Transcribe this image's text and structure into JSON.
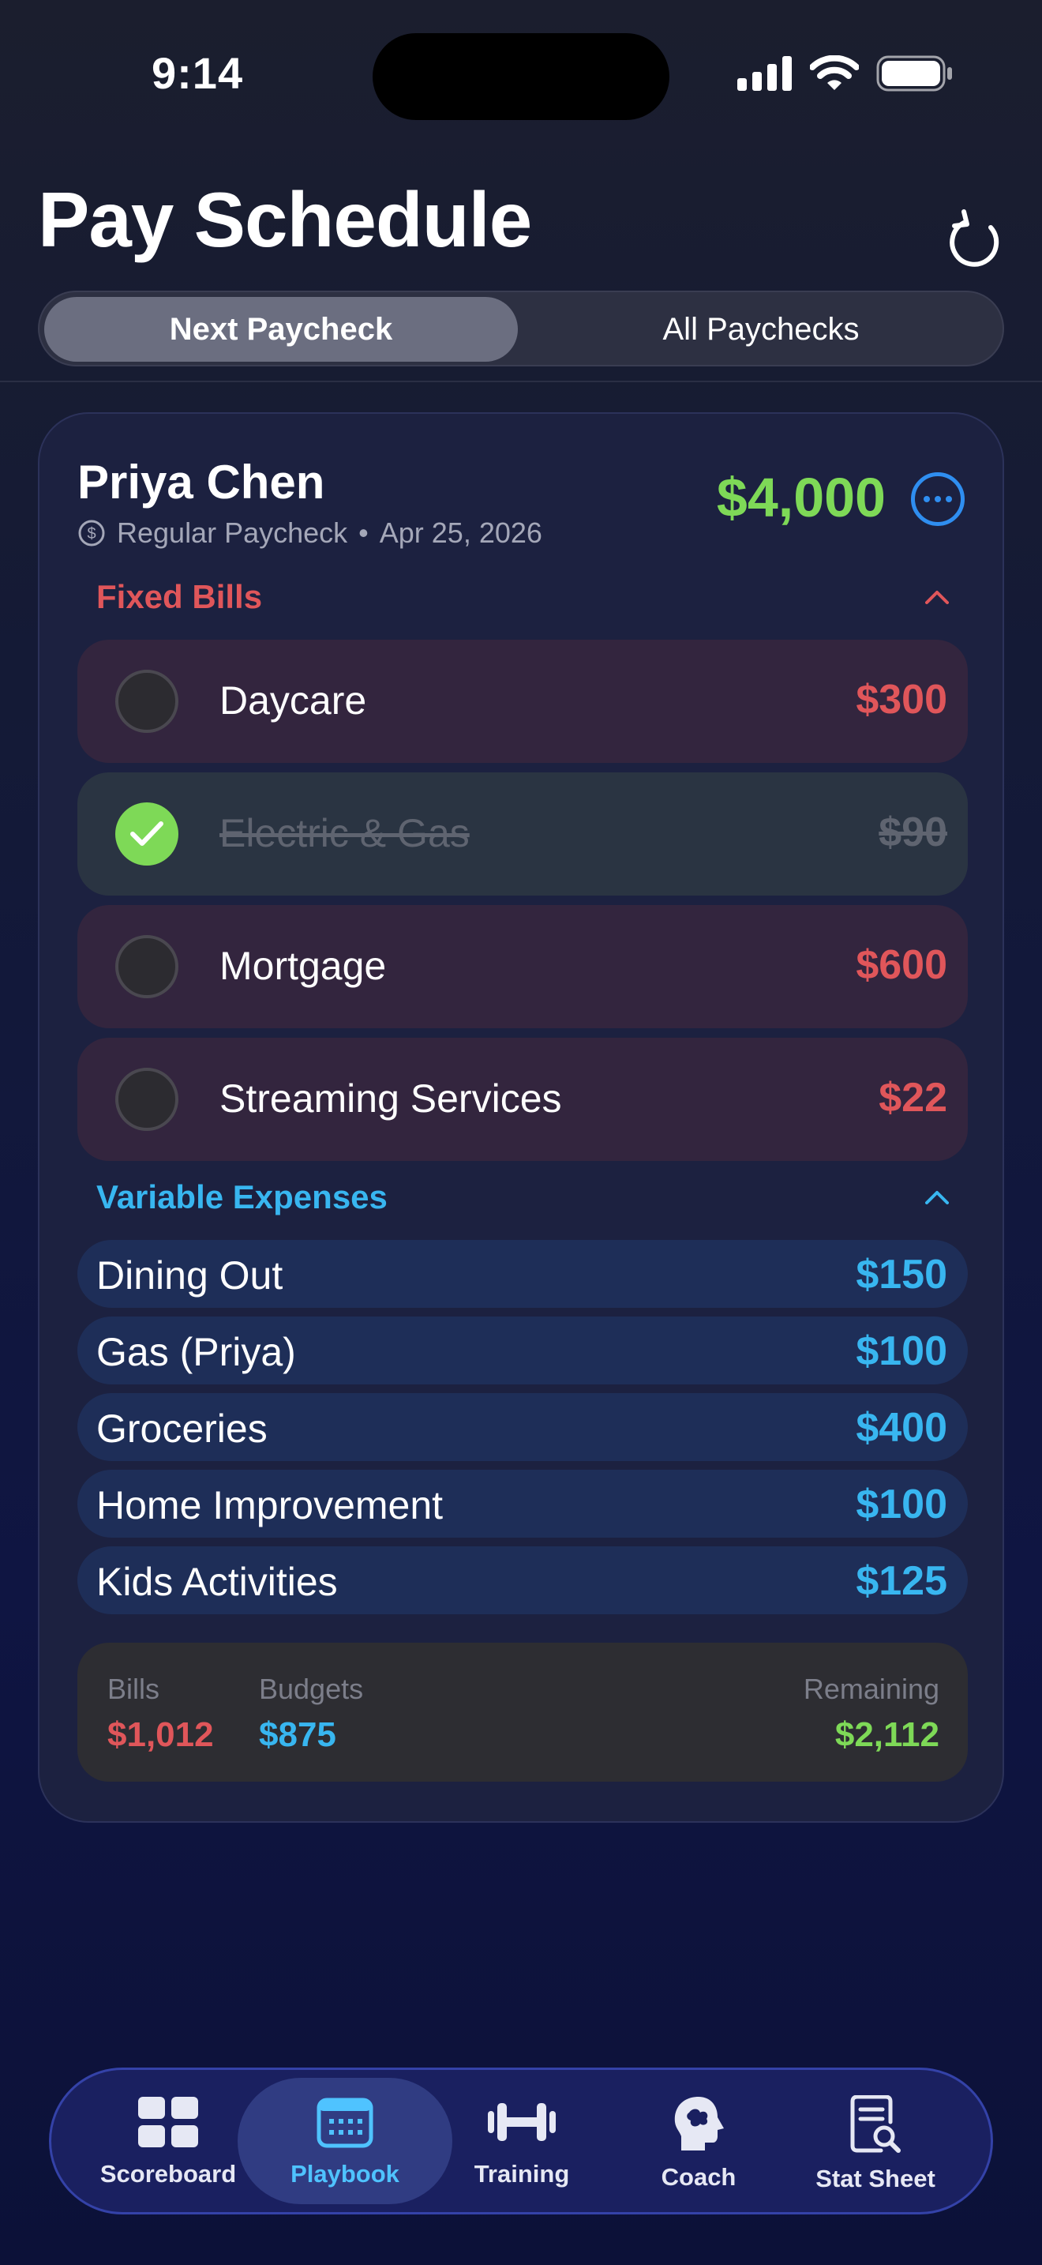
{
  "status_bar": {
    "time": "9:14"
  },
  "header": {
    "title": "Pay Schedule",
    "tabs": [
      {
        "label": "Next Paycheck",
        "active": true
      },
      {
        "label": "All Paychecks",
        "active": false
      }
    ]
  },
  "paycheck": {
    "person": "Priya Chen",
    "type": "Regular Paycheck",
    "separator": "•",
    "date": "Apr 25, 2026",
    "amount": "$4,000"
  },
  "fixed_bills": {
    "title": "Fixed Bills",
    "items": [
      {
        "name": "Daycare",
        "amount": "$300",
        "paid": false
      },
      {
        "name": "Electric & Gas",
        "amount": "$90",
        "paid": true
      },
      {
        "name": "Mortgage",
        "amount": "$600",
        "paid": false
      },
      {
        "name": "Streaming Services",
        "amount": "$22",
        "paid": false
      }
    ]
  },
  "variable_expenses": {
    "title": "Variable Expenses",
    "items": [
      {
        "name": "Dining Out",
        "amount": "$150"
      },
      {
        "name": "Gas (Priya)",
        "amount": "$100"
      },
      {
        "name": "Groceries",
        "amount": "$400"
      },
      {
        "name": "Home Improvement",
        "amount": "$100"
      },
      {
        "name": "Kids Activities",
        "amount": "$125"
      }
    ]
  },
  "summary": {
    "bills_label": "Bills",
    "bills_value": "$1,012",
    "budgets_label": "Budgets",
    "budgets_value": "$875",
    "remaining_label": "Remaining",
    "remaining_value": "$2,112"
  },
  "tab_bar": {
    "items": [
      {
        "label": "Scoreboard",
        "icon": "grid-icon",
        "active": false
      },
      {
        "label": "Playbook",
        "icon": "calendar-icon",
        "active": true
      },
      {
        "label": "Training",
        "icon": "dumbbell-icon",
        "active": false
      },
      {
        "label": "Coach",
        "icon": "brain-head-icon",
        "active": false
      },
      {
        "label": "Stat Sheet",
        "icon": "document-search-icon",
        "active": false
      }
    ]
  },
  "colors": {
    "bills_red": "#e0565a",
    "budget_blue": "#38b6f0",
    "positive_green": "#7ed957",
    "accent_blue": "#2f8ef0"
  }
}
